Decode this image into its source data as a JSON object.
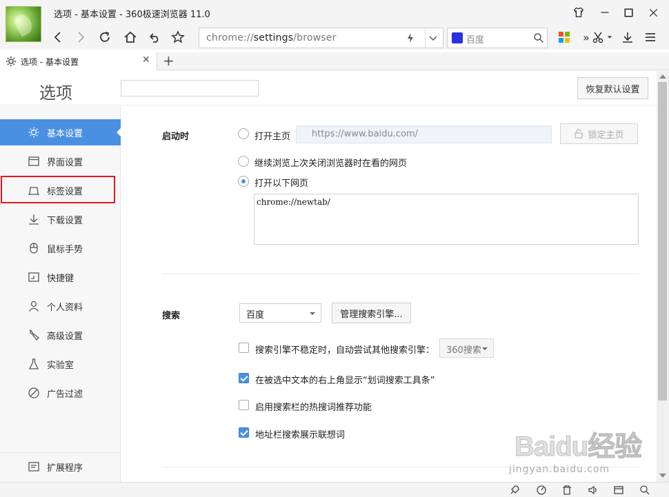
{
  "window": {
    "title": "选项 - 基本设置 - 360极速浏览器 11.0"
  },
  "toolbar": {
    "address_prefix": "chrome://",
    "address_bold": "settings",
    "address_suffix": "/browser",
    "search_engine": "百度"
  },
  "tabs": [
    {
      "label": "选项 - 基本设置"
    }
  ],
  "page": {
    "title": "选项",
    "search_placeholder": "",
    "restore_label": "恢复默认设置"
  },
  "sidebar": {
    "items": [
      {
        "label": "基本设置",
        "icon": "sun-icon",
        "active": true
      },
      {
        "label": "界面设置",
        "icon": "window-icon"
      },
      {
        "label": "标签设置",
        "icon": "tab-icon"
      },
      {
        "label": "下载设置",
        "icon": "download-icon"
      },
      {
        "label": "鼠标手势",
        "icon": "mouse-icon"
      },
      {
        "label": "快捷键",
        "icon": "keyboard-icon"
      },
      {
        "label": "个人资料",
        "icon": "user-icon"
      },
      {
        "label": "高级设置",
        "icon": "wrench-icon"
      },
      {
        "label": "实验室",
        "icon": "flask-icon"
      },
      {
        "label": "广告过滤",
        "icon": "block-icon"
      }
    ],
    "extensions_label": "扩展程序"
  },
  "startup": {
    "label": "启动时",
    "open_homepage": "打开主页",
    "homepage_url": "https://www.baidu.com/",
    "lock_label": "锁定主页",
    "continue_label": "继续浏览上次关闭浏览器时在看的网页",
    "open_pages_label": "打开以下网页",
    "pages_value": "chrome://newtab/",
    "selected": "open_pages"
  },
  "search": {
    "label": "搜索",
    "engine_selected": "百度",
    "manage_label": "管理搜索引擎...",
    "fallback_label": "搜索引擎不稳定时，自动尝试其他搜索引擎：",
    "fallback_engine": "360搜索",
    "fallback_checked": false,
    "show_toolbar_label": "在被选中文本的右上角显示“划词搜索工具条”",
    "show_toolbar_checked": true,
    "hot_words_label": "启用搜索栏的热搜词推荐功能",
    "hot_words_checked": false,
    "suggest_label": "地址栏搜索展示联想词",
    "suggest_checked": true
  },
  "watermark": {
    "main": "Baidu经验",
    "sub": "jingyan.baidu.com"
  },
  "colors": {
    "accent": "#4a90e2",
    "highlight_box": "#e0181e"
  }
}
